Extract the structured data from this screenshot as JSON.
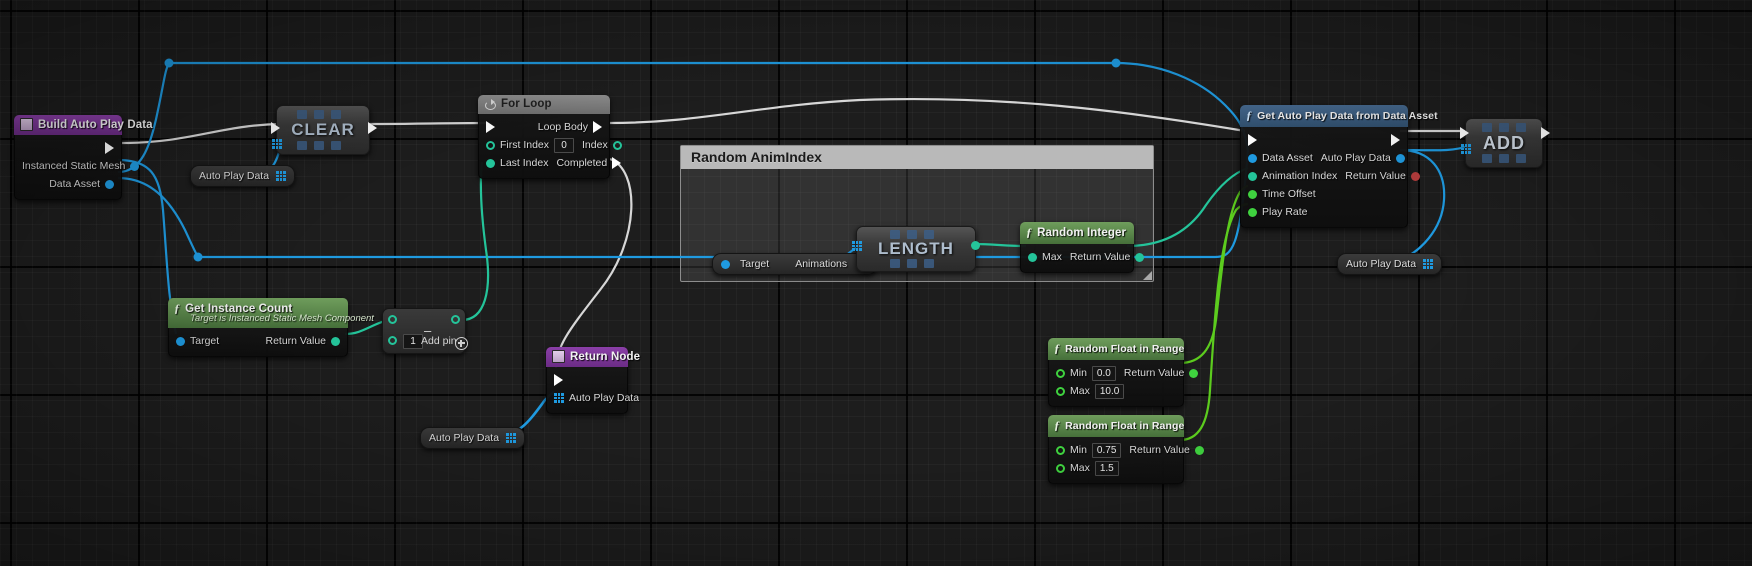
{
  "app": {
    "editor": "Unreal Engine Blueprint Graph",
    "background_color": "#1d1d1d"
  },
  "comment": {
    "title": "Random AnimIndex",
    "border_color": "#8d8d8d",
    "title_bg": "#b9b9b9"
  },
  "nodes": {
    "build_auto_play_data": {
      "title": "Build Auto Play Data",
      "header_color": "#7a3597",
      "outputs": [
        {
          "label": "",
          "type": "exec"
        },
        {
          "label": "Instanced Static Mesh",
          "type": "object"
        },
        {
          "label": "Data Asset",
          "type": "object"
        }
      ]
    },
    "clear": {
      "title": "CLEAR",
      "kind": "operator"
    },
    "for_loop": {
      "title": "For Loop",
      "header_color": "#6f6f6f",
      "inputs": [
        {
          "label": "",
          "type": "exec"
        },
        {
          "label": "First Index",
          "type": "int",
          "value": "0"
        },
        {
          "label": "Last Index",
          "type": "int",
          "value": ""
        }
      ],
      "outputs": [
        {
          "label": "Loop Body",
          "type": "exec"
        },
        {
          "label": "Index",
          "type": "int"
        },
        {
          "label": "Completed",
          "type": "exec"
        }
      ]
    },
    "get_instance_count": {
      "title": "Get Instance Count",
      "subtitle": "Target is Instanced Static Mesh Component",
      "header_color": "#5d8b4b",
      "inputs": [
        {
          "label": "Target",
          "type": "object"
        }
      ],
      "outputs": [
        {
          "label": "Return Value",
          "type": "int"
        }
      ]
    },
    "subtract": {
      "title": "",
      "operator": "–",
      "value": "1",
      "add_pin_label": "Add pin"
    },
    "return_node": {
      "title": "Return Node",
      "header_color": "#7a3597",
      "inputs": [
        {
          "label": "",
          "type": "exec"
        },
        {
          "label": "Auto Play Data",
          "type": "array"
        }
      ]
    },
    "length": {
      "title": "LENGTH",
      "kind": "operator"
    },
    "animations_getter": {
      "label_left": "Target",
      "label_right": "Animations"
    },
    "random_integer": {
      "title": "Random Integer",
      "header_color": "#5d8b4b",
      "inputs": [
        {
          "label": "Max",
          "type": "int"
        }
      ],
      "outputs": [
        {
          "label": "Return Value",
          "type": "int"
        }
      ]
    },
    "get_auto_play_data_from_data_asset": {
      "title": "Get Auto Play Data from Data Asset",
      "header_color": "#3e6189",
      "inputs": [
        {
          "label": "",
          "type": "exec"
        },
        {
          "label": "Data Asset",
          "type": "object"
        },
        {
          "label": "Animation Index",
          "type": "int"
        },
        {
          "label": "Time Offset",
          "type": "float"
        },
        {
          "label": "Play Rate",
          "type": "float"
        }
      ],
      "outputs": [
        {
          "label": "",
          "type": "exec"
        },
        {
          "label": "Auto Play Data",
          "type": "struct"
        },
        {
          "label": "Return Value",
          "type": "bool"
        }
      ]
    },
    "add": {
      "title": "ADD",
      "kind": "operator"
    },
    "random_float_in_range_1": {
      "title": "Random Float in Range",
      "header_color": "#5d8b4b",
      "inputs": [
        {
          "label": "Min",
          "type": "float",
          "value": "0.0"
        },
        {
          "label": "Max",
          "type": "float",
          "value": "10.0"
        }
      ],
      "outputs": [
        {
          "label": "Return Value",
          "type": "float"
        }
      ]
    },
    "random_float_in_range_2": {
      "title": "Random Float in Range",
      "header_color": "#5d8b4b",
      "inputs": [
        {
          "label": "Min",
          "type": "float",
          "value": "0.75"
        },
        {
          "label": "Max",
          "type": "float",
          "value": "1.5"
        }
      ],
      "outputs": [
        {
          "label": "Return Value",
          "type": "float"
        }
      ]
    },
    "auto_play_data_var_1": {
      "label": "Auto Play Data"
    },
    "auto_play_data_var_2": {
      "label": "Auto Play Data"
    },
    "auto_play_data_var_3": {
      "label": "Auto Play Data"
    }
  },
  "wire_colors": {
    "exec": "#d7d7d7",
    "object": "#1f9ae0",
    "array_object": "#1f9ae0",
    "int": "#24c49a",
    "float": "#5ccc1e",
    "struct": "#1f9ae0"
  }
}
